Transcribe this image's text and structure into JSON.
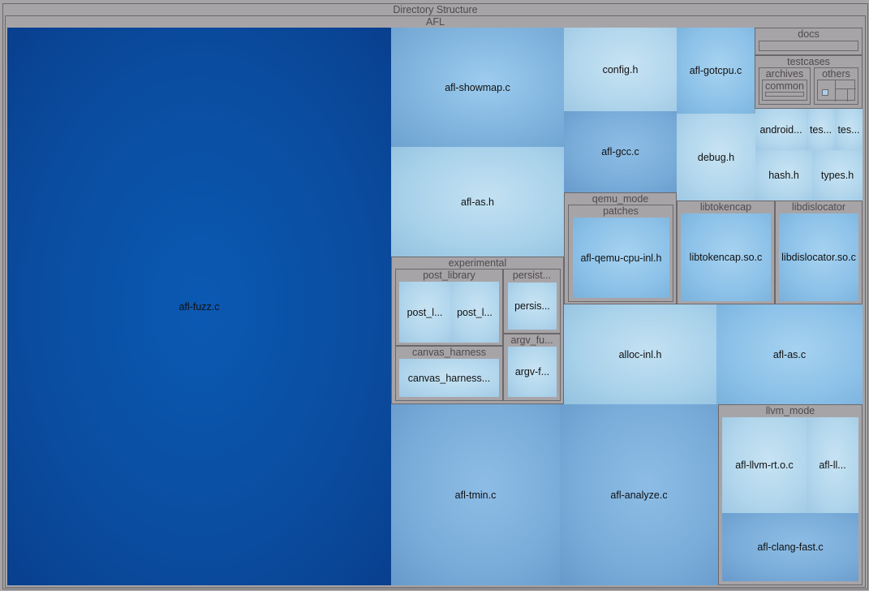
{
  "title": "Directory Structure",
  "root": "AFL",
  "files": {
    "afl_fuzz": "afl-fuzz.c",
    "afl_showmap": "afl-showmap.c",
    "config_h": "config.h",
    "afl_gotcpu": "afl-gotcpu.c",
    "afl_as_h": "afl-as.h",
    "afl_gcc": "afl-gcc.c",
    "debug_h": "debug.h",
    "android": "android...",
    "tes1": "tes...",
    "tes2": "tes...",
    "hash_h": "hash.h",
    "types_h": "types.h",
    "qemu_cpu": "afl-qemu-cpu-inl.h",
    "libtokencap_so": "libtokencap.so.c",
    "libdislocator_so": "libdislocator.so.c",
    "post_l1": "post_l...",
    "post_l2": "post_l...",
    "persis": "persis...",
    "canvas_file": "canvas_harness...",
    "argv_f": "argv-f...",
    "alloc_inl": "alloc-inl.h",
    "afl_as_c": "afl-as.c",
    "afl_tmin": "afl-tmin.c",
    "afl_analyze": "afl-analyze.c",
    "llvm_rt": "afl-llvm-rt.o.c",
    "afl_ll": "afl-ll...",
    "clang_fast": "afl-clang-fast.c"
  },
  "dirs": {
    "docs": "docs",
    "testcases": "testcases",
    "archives": "archives",
    "common": "common",
    "others": "others",
    "qemu_mode": "qemu_mode",
    "patches": "patches",
    "libtokencap": "libtokencap",
    "libdislocator": "libdislocator",
    "experimental": "experimental",
    "post_library": "post_library",
    "persist": "persist...",
    "canvas_harness": "canvas_harness",
    "argv_fu": "argv_fu...",
    "llvm_mode": "llvm_mode"
  }
}
